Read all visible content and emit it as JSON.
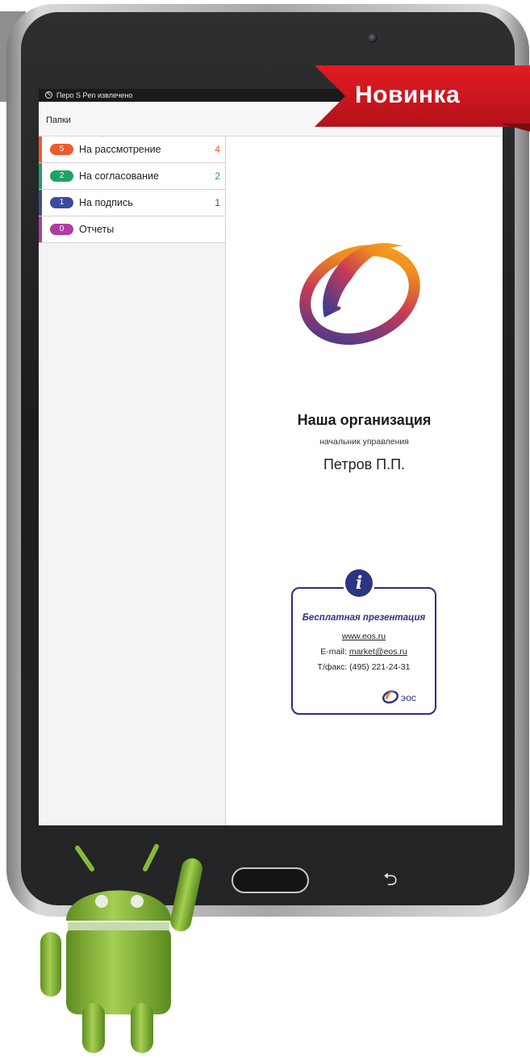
{
  "status_bar": {
    "text": "Перо S Pen извлечено"
  },
  "header": {
    "folders_label": "Папки"
  },
  "folders": [
    {
      "badge": "5",
      "label": "На рассмотрение",
      "count": "4",
      "color": "#ef5a2a"
    },
    {
      "badge": "2",
      "label": "На согласование",
      "count": "2",
      "color": "#1ea165"
    },
    {
      "badge": "1",
      "label": "На подпись",
      "count": "1",
      "color": "#3c4a9e"
    },
    {
      "badge": "0",
      "label": "Отчеты",
      "count": "",
      "color": "#b03ba4"
    }
  ],
  "organization": {
    "name": "Наша организация",
    "role": "начальник управления",
    "person": "Петров П.П."
  },
  "info_box": {
    "icon": "i",
    "title": "Бесплатная презентация",
    "url": "www.eos.ru",
    "email_prefix": "E-mail: ",
    "email": "market@eos.ru",
    "phone": "Т/факс: (495) 221-24-31",
    "brand": "эос"
  },
  "ribbon": {
    "text": "Новинка"
  },
  "colors": {
    "accent_red": "#e31b23",
    "brand_blue": "#2c3483",
    "brand_orange": "#f08c1d"
  }
}
